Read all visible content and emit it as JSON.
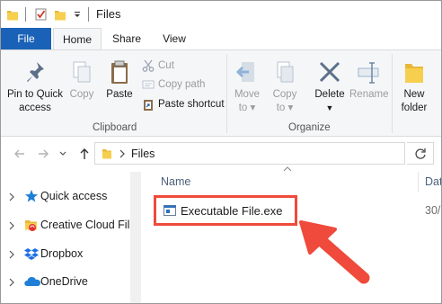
{
  "window": {
    "title": "Files"
  },
  "ribbon_tabs": [
    {
      "label": "File"
    },
    {
      "label": "Home"
    },
    {
      "label": "Share"
    },
    {
      "label": "View"
    }
  ],
  "clipboard": {
    "pin_label_line1": "Pin to Quick",
    "pin_label_line2": "access",
    "copy_label": "Copy",
    "paste_label": "Paste",
    "cut_label": "Cut",
    "copy_path_label": "Copy path",
    "paste_shortcut_label": "Paste shortcut",
    "group_label": "Clipboard"
  },
  "organize": {
    "move_to_line1": "Move",
    "move_to_line2": "to",
    "copy_to_line1": "Copy",
    "copy_to_line2": "to",
    "delete_label": "Delete",
    "rename_label": "Rename",
    "group_label": "Organize"
  },
  "new_group": {
    "new_folder_line1": "New",
    "new_folder_line2": "folder"
  },
  "address": {
    "path": "Files"
  },
  "nav_pane": {
    "items": [
      {
        "label": "Quick access",
        "icon": "star-icon"
      },
      {
        "label": "Creative Cloud Files",
        "icon": "creative-cloud-folder-icon"
      },
      {
        "label": "Dropbox",
        "icon": "dropbox-icon"
      },
      {
        "label": "OneDrive",
        "icon": "onedrive-icon"
      }
    ]
  },
  "file_list": {
    "columns": {
      "name": "Name",
      "date": "Dat"
    },
    "rows": [
      {
        "name": "Executable File.exe",
        "date": "30/"
      }
    ]
  },
  "colors": {
    "file_tab": "#1a62b7",
    "highlight": "#ef4a3b",
    "ribbon_bg": "#f5f6f7"
  }
}
